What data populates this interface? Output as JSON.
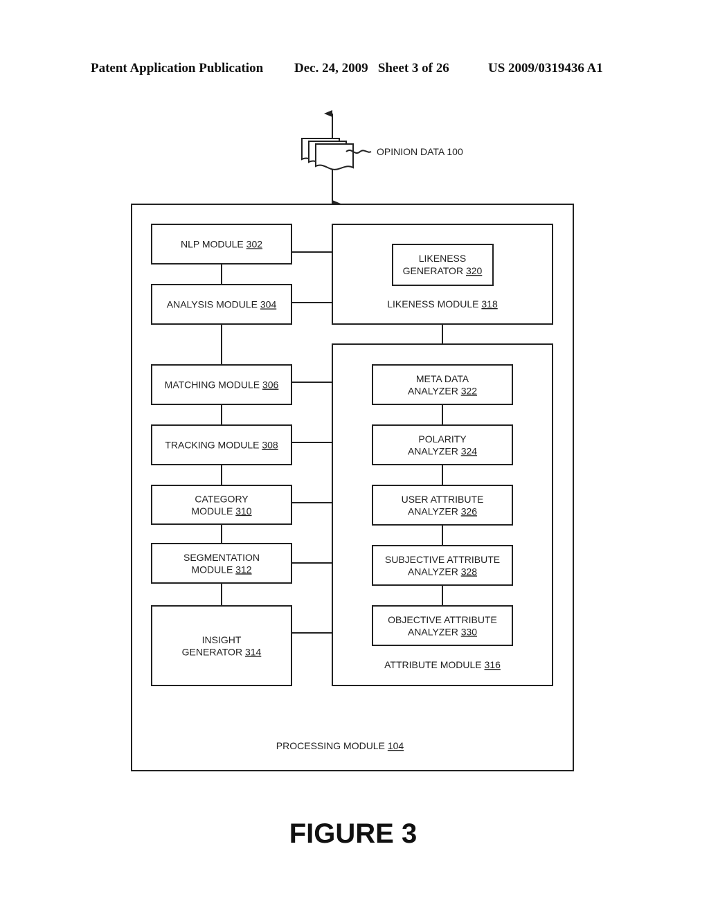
{
  "header": {
    "left": "Patent Application Publication",
    "middle": "Dec. 24, 2009   Sheet 3 of 26",
    "right": "US 2009/0319436 A1"
  },
  "opinion_data": {
    "label": "OPINION DATA",
    "ref": "100",
    "icon": "document-stack-icon"
  },
  "processing_module": {
    "label": "PROCESSING MODULE",
    "ref": "104"
  },
  "left_modules": [
    {
      "id": "nlp",
      "lines": [
        "NLP MODULE"
      ],
      "ref": "302"
    },
    {
      "id": "analysis",
      "lines": [
        "ANALYSIS MODULE"
      ],
      "ref": "304"
    },
    {
      "id": "matching",
      "lines": [
        "MATCHING MODULE"
      ],
      "ref": "306"
    },
    {
      "id": "tracking",
      "lines": [
        "TRACKING MODULE"
      ],
      "ref": "308"
    },
    {
      "id": "category",
      "lines": [
        "CATEGORY",
        "MODULE"
      ],
      "ref": "310"
    },
    {
      "id": "segmentation",
      "lines": [
        "SEGMENTATION",
        "MODULE"
      ],
      "ref": "312"
    },
    {
      "id": "insight",
      "lines": [
        "INSIGHT",
        "GENERATOR"
      ],
      "ref": "314"
    }
  ],
  "likeness_module": {
    "label": "LIKENESS MODULE",
    "ref": "318",
    "generator": {
      "lines": [
        "LIKENESS",
        "GENERATOR"
      ],
      "ref": "320"
    }
  },
  "attribute_module": {
    "label": "ATTRIBUTE MODULE",
    "ref": "316",
    "analyzers": [
      {
        "id": "meta",
        "lines": [
          "META DATA",
          "ANALYZER"
        ],
        "ref": "322"
      },
      {
        "id": "polarity",
        "lines": [
          "POLARITY",
          "ANALYZER"
        ],
        "ref": "324"
      },
      {
        "id": "user",
        "lines": [
          "USER ATTRIBUTE",
          "ANALYZER"
        ],
        "ref": "326"
      },
      {
        "id": "subjective",
        "lines": [
          "SUBJECTIVE ATTRIBUTE",
          "ANALYZER"
        ],
        "ref": "328"
      },
      {
        "id": "objective",
        "lines": [
          "OBJECTIVE ATTRIBUTE",
          "ANALYZER"
        ],
        "ref": "330"
      }
    ]
  },
  "figure_caption": "FIGURE 3"
}
